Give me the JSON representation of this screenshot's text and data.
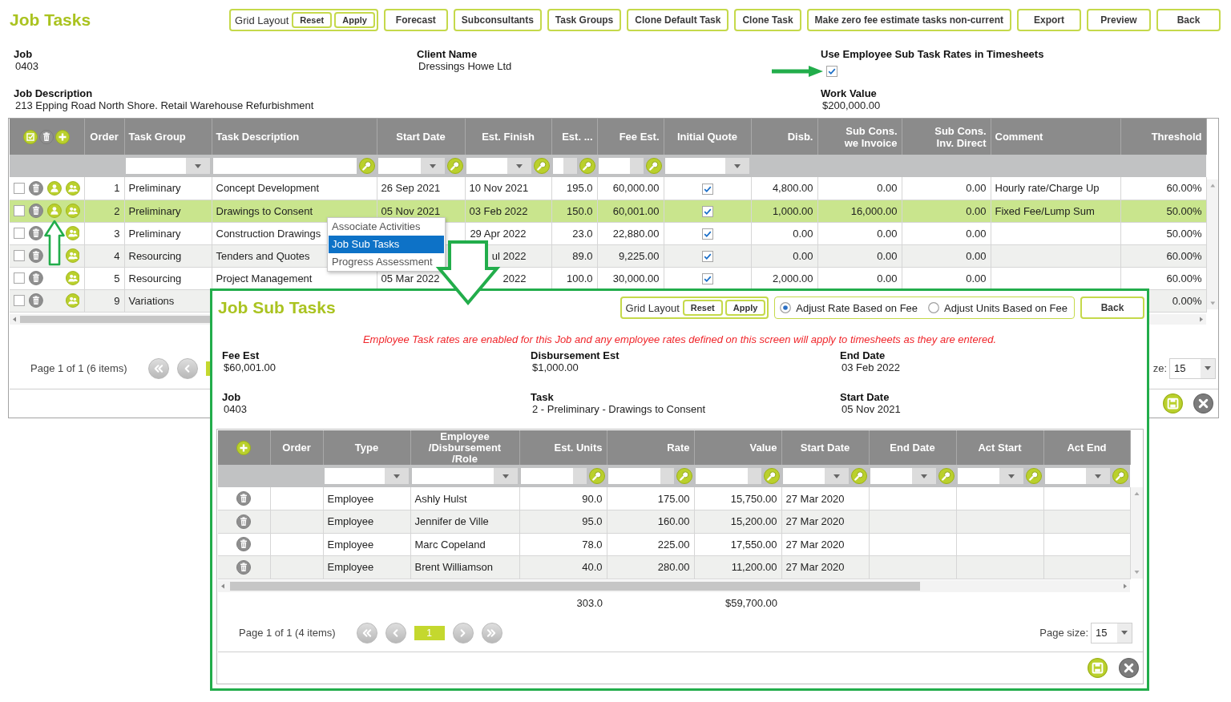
{
  "header": {
    "title": "Job Tasks",
    "grid_layout": {
      "label": "Grid Layout",
      "buttons": [
        "Reset",
        "Apply"
      ]
    },
    "buttons": [
      "Forecast",
      "Subconsultants",
      "Task Groups",
      "Clone Default Task",
      "Clone Task",
      "Make zero fee estimate tasks non-current",
      "Export",
      "Preview",
      "Back"
    ]
  },
  "job_details": {
    "job": {
      "label": "Job",
      "value": "0403"
    },
    "client_name": {
      "label": "Client Name",
      "value": "Dressings Howe Ltd"
    },
    "employee_rates": {
      "label": "Use Employee Sub Task Rates in Timesheets",
      "checked": true
    },
    "job_description": {
      "label": "Job Description",
      "value": "213 Epping Road North Shore. Retail Warehouse Refurbishment"
    },
    "work_value": {
      "label": "Work Value",
      "value": "$200,000.00"
    }
  },
  "tasks_grid": {
    "columns": [
      {
        "label": "Order",
        "kind": "order"
      },
      {
        "label": "Task Group",
        "kind": "text",
        "filter": {
          "kind": "select"
        }
      },
      {
        "label": "Task Description",
        "kind": "text",
        "filter": {
          "kind": "input_search"
        }
      },
      {
        "label": "Start Date",
        "kind": "date",
        "filter": {
          "kind": "select_search"
        }
      },
      {
        "label": "Est. Finish",
        "kind": "date",
        "filter": {
          "kind": "select_search"
        }
      },
      {
        "label": "Est. ...",
        "kind": "number",
        "filter": {
          "kind": "input_search"
        }
      },
      {
        "label": "Fee Est.",
        "kind": "number",
        "filter": {
          "kind": "input_search"
        }
      },
      {
        "label": "Initial Quote",
        "kind": "check",
        "filter": {
          "kind": "select"
        }
      },
      {
        "label": "Disb.",
        "kind": "number"
      },
      {
        "label": "Sub Cons.\nwe Invoice",
        "kind": "number"
      },
      {
        "label": "Sub Cons.\nInv. Direct",
        "kind": "number"
      },
      {
        "label": "Comment",
        "kind": "text"
      },
      {
        "label": "Threshold",
        "kind": "number"
      }
    ],
    "rows": [
      {
        "selected": false,
        "checked": false,
        "sub_task_action": true,
        "order": "1",
        "task_group": "Preliminary",
        "task_description": "Concept Development",
        "start_date": "26 Sep 2021",
        "est_finish": "10 Nov 2021",
        "est": "195.0",
        "fee_est": "60,000.00",
        "initial_quote": true,
        "disb": "4,800.00",
        "sub_cons_we_invoice": "0.00",
        "sub_cons_inv_direct": "0.00",
        "comment": "Hourly rate/Charge Up",
        "threshold": "60.00%"
      },
      {
        "selected": true,
        "checked": false,
        "sub_task_action": true,
        "order": "2",
        "task_group": "Preliminary",
        "task_description": "Drawings to Consent",
        "start_date": "05 Nov 2021",
        "est_finish": "03 Feb 2022",
        "est": "150.0",
        "fee_est": "60,001.00",
        "initial_quote": true,
        "disb": "1,000.00",
        "sub_cons_we_invoice": "16,000.00",
        "sub_cons_inv_direct": "0.00",
        "comment": "Fixed Fee/Lump Sum",
        "threshold": "50.00%"
      },
      {
        "selected": false,
        "checked": false,
        "sub_task_action": false,
        "order": "3",
        "task_group": "Preliminary",
        "task_description": "Construction Drawings",
        "est_finish": "29 Apr 2022",
        "est": "23.0",
        "fee_est": "22,880.00",
        "initial_quote": true,
        "disb": "0.00",
        "sub_cons_we_invoice": "0.00",
        "sub_cons_inv_direct": "0.00",
        "threshold": "50.00%"
      },
      {
        "selected": false,
        "checked": false,
        "sub_task_action": false,
        "order": "4",
        "task_group": "Resourcing",
        "task_description": "Tenders and Quotes",
        "est_finish": "ul 2022",
        "est": "89.0",
        "fee_est": "9,225.00",
        "initial_quote": true,
        "disb": "0.00",
        "sub_cons_we_invoice": "0.00",
        "sub_cons_inv_direct": "0.00",
        "threshold": "60.00%"
      },
      {
        "selected": false,
        "checked": false,
        "sub_task_action": false,
        "order": "5",
        "task_group": "Resourcing",
        "task_description": "Project Management",
        "start_date": "05 Mar 2022",
        "est_finish": "2022",
        "est": "100.0",
        "fee_est": "30,000.00",
        "initial_quote": true,
        "disb": "2,000.00",
        "sub_cons_we_invoice": "0.00",
        "sub_cons_inv_direct": "0.00",
        "threshold": "60.00%"
      },
      {
        "selected": false,
        "checked": false,
        "sub_task_action": false,
        "order": "9",
        "task_group": "Variations",
        "threshold": "0.00%"
      }
    ]
  },
  "tasks_pager": {
    "summary": "Page 1 of 1 (6 items)",
    "controls": [
      {
        "kind": "first"
      },
      {
        "kind": "previous"
      },
      {
        "kind": "page",
        "selected": true
      }
    ],
    "page_size_label": "ze:",
    "page_size": "15"
  },
  "context_menu": {
    "items": [
      {
        "label": "Associate Activities",
        "selected": false
      },
      {
        "label": "Job Sub Tasks",
        "selected": true
      },
      {
        "label": "Progress Assessment",
        "selected": false
      }
    ]
  },
  "sub_tasks_panel": {
    "title": "Job Sub Tasks",
    "grid_layout": {
      "label": "Grid Layout",
      "buttons": [
        "Reset",
        "Apply"
      ]
    },
    "adjust_options": [
      {
        "label": "Adjust Rate Based on Fee",
        "selected": true
      },
      {
        "label": "Adjust Units Based on Fee",
        "selected": false
      }
    ],
    "back_button": "Back",
    "notice": "Employee Task rates are enabled for this Job and any employee rates defined on this screen will apply to timesheets as they are entered.",
    "details": [
      {
        "label": "Fee Est",
        "value": "$60,001.00"
      },
      {
        "label": "Disbursement Est",
        "value": "$1,000.00"
      },
      {
        "label": "End Date",
        "value": "03 Feb 2022"
      },
      {
        "label": "Job",
        "value": "0403"
      },
      {
        "label": "Task",
        "value": "2 - Preliminary - Drawings to Consent"
      },
      {
        "label": "Start Date",
        "value": "05 Nov 2021"
      }
    ],
    "grid": {
      "columns": [
        {
          "label": "Order",
          "kind": "order"
        },
        {
          "label": "Type",
          "kind": "text",
          "filter": {
            "kind": "select"
          }
        },
        {
          "label": "Employee\n/Disbursement\n/Role",
          "kind": "text",
          "filter": {
            "kind": "select"
          }
        },
        {
          "label": "Est. Units",
          "kind": "number",
          "filter": {
            "kind": "input_search"
          }
        },
        {
          "label": "Rate",
          "kind": "number",
          "filter": {
            "kind": "input_search"
          }
        },
        {
          "label": "Value",
          "kind": "number",
          "filter": {
            "kind": "input_search"
          }
        },
        {
          "label": "Start Date",
          "kind": "date",
          "filter": {
            "kind": "select_search"
          }
        },
        {
          "label": "End Date",
          "kind": "date",
          "filter": {
            "kind": "select_search"
          }
        },
        {
          "label": "Act Start",
          "kind": "date",
          "filter": {
            "kind": "select_search"
          }
        },
        {
          "label": "Act End",
          "kind": "date",
          "filter": {
            "kind": "select_search"
          }
        }
      ],
      "rows": [
        {
          "selected": false,
          "type": "Employee",
          "employee": "Ashly Hulst",
          "est_units": "90.0",
          "rate": "175.00",
          "value": "15,750.00",
          "start_date": "27 Mar 2020"
        },
        {
          "selected": false,
          "type": "Employee",
          "employee": "Jennifer de Ville",
          "est_units": "95.0",
          "rate": "160.00",
          "value": "15,200.00",
          "start_date": "27 Mar 2020"
        },
        {
          "selected": false,
          "type": "Employee",
          "employee": "Marc Copeland",
          "est_units": "78.0",
          "rate": "225.00",
          "value": "17,550.00",
          "start_date": "27 Mar 2020"
        },
        {
          "selected": false,
          "type": "Employee",
          "employee": "Brent Williamson",
          "est_units": "40.0",
          "rate": "280.00",
          "value": "11,200.00",
          "start_date": "27 Mar 2020"
        }
      ],
      "totals": {
        "est_units": "303.0",
        "value": "$59,700.00"
      }
    },
    "pager": {
      "summary": "Page 1 of 1 (4 items)",
      "controls": [
        {
          "kind": "first"
        },
        {
          "kind": "previous"
        },
        {
          "kind": "page",
          "label": "1",
          "selected": true
        },
        {
          "kind": "next"
        },
        {
          "kind": "last"
        }
      ],
      "page_size_label": "Page size:",
      "page_size": "15"
    }
  }
}
